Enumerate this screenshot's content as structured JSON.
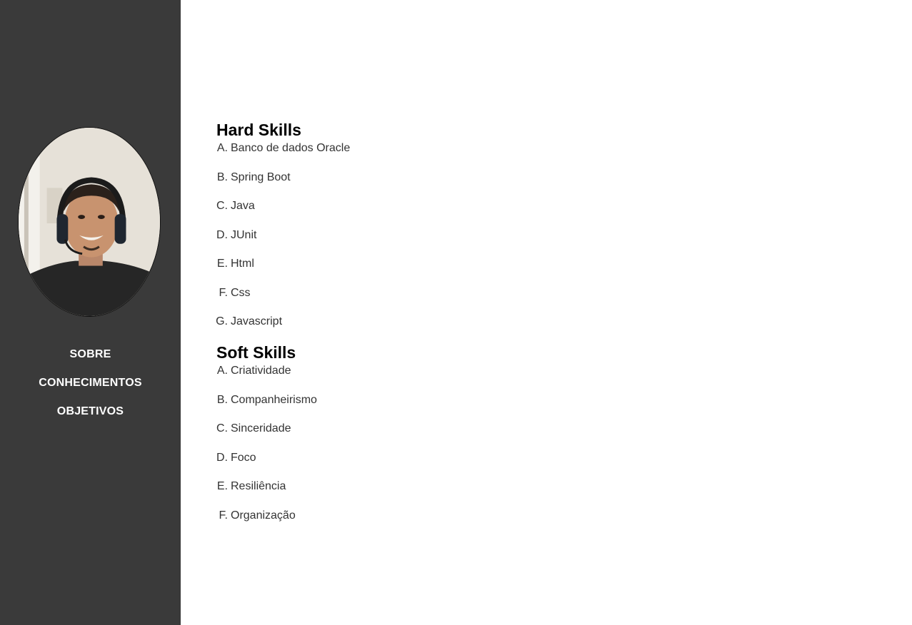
{
  "sidebar": {
    "avatar_alt": "Profile photo",
    "nav": [
      {
        "label": "SOBRE"
      },
      {
        "label": "CONHECIMENTOS"
      },
      {
        "label": "OBJETIVOS"
      }
    ]
  },
  "hard_skills": {
    "title": "Hard Skills",
    "items": [
      {
        "marker": "A.",
        "label": "Banco de dados Oracle"
      },
      {
        "marker": "B.",
        "label": "Spring Boot"
      },
      {
        "marker": "C.",
        "label": "Java"
      },
      {
        "marker": "D.",
        "label": "JUnit"
      },
      {
        "marker": "E.",
        "label": "Html"
      },
      {
        "marker": "F.",
        "label": "Css"
      },
      {
        "marker": "G.",
        "label": "Javascript"
      }
    ]
  },
  "soft_skills": {
    "title": "Soft Skills",
    "items": [
      {
        "marker": "A.",
        "label": "Criatividade"
      },
      {
        "marker": "B.",
        "label": "Companheirismo"
      },
      {
        "marker": "C.",
        "label": "Sinceridade"
      },
      {
        "marker": "D.",
        "label": "Foco"
      },
      {
        "marker": "E.",
        "label": "Resiliência"
      },
      {
        "marker": "F.",
        "label": "Organização"
      }
    ]
  },
  "colors": {
    "sidebar_bg": "#3a3a3a",
    "nav_text": "#ffffff",
    "heading_text": "#000000",
    "body_text": "#333333"
  }
}
